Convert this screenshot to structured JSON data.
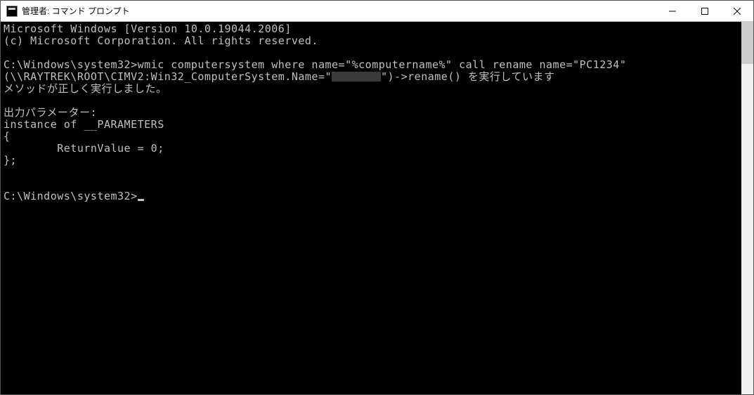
{
  "titlebar": {
    "icon_label": "C:\\",
    "title": "管理者: コマンド プロンプト"
  },
  "terminal": {
    "line1": "Microsoft Windows [Version 10.0.19044.2006]",
    "line2": "(c) Microsoft Corporation. All rights reserved.",
    "blank1": "",
    "prompt1_path": "C:\\Windows\\system32>",
    "prompt1_cmd": "wmic computersystem where name=\"%computername%\" call rename name=\"PC1234\"",
    "line4a": "(\\\\RAYTREK\\ROOT\\CIMV2:Win32_ComputerSystem.Name=\"",
    "line4b": "\")->rename() を実行しています",
    "line5": "メソッドが正しく実行しました。",
    "blank2": "",
    "line6": "出力パラメーター:",
    "line7": "instance of __PARAMETERS",
    "line8": "{",
    "line9": "        ReturnValue = 0;",
    "line10": "};",
    "blank3": "",
    "blank4": "",
    "prompt2_path": "C:\\Windows\\system32>"
  }
}
